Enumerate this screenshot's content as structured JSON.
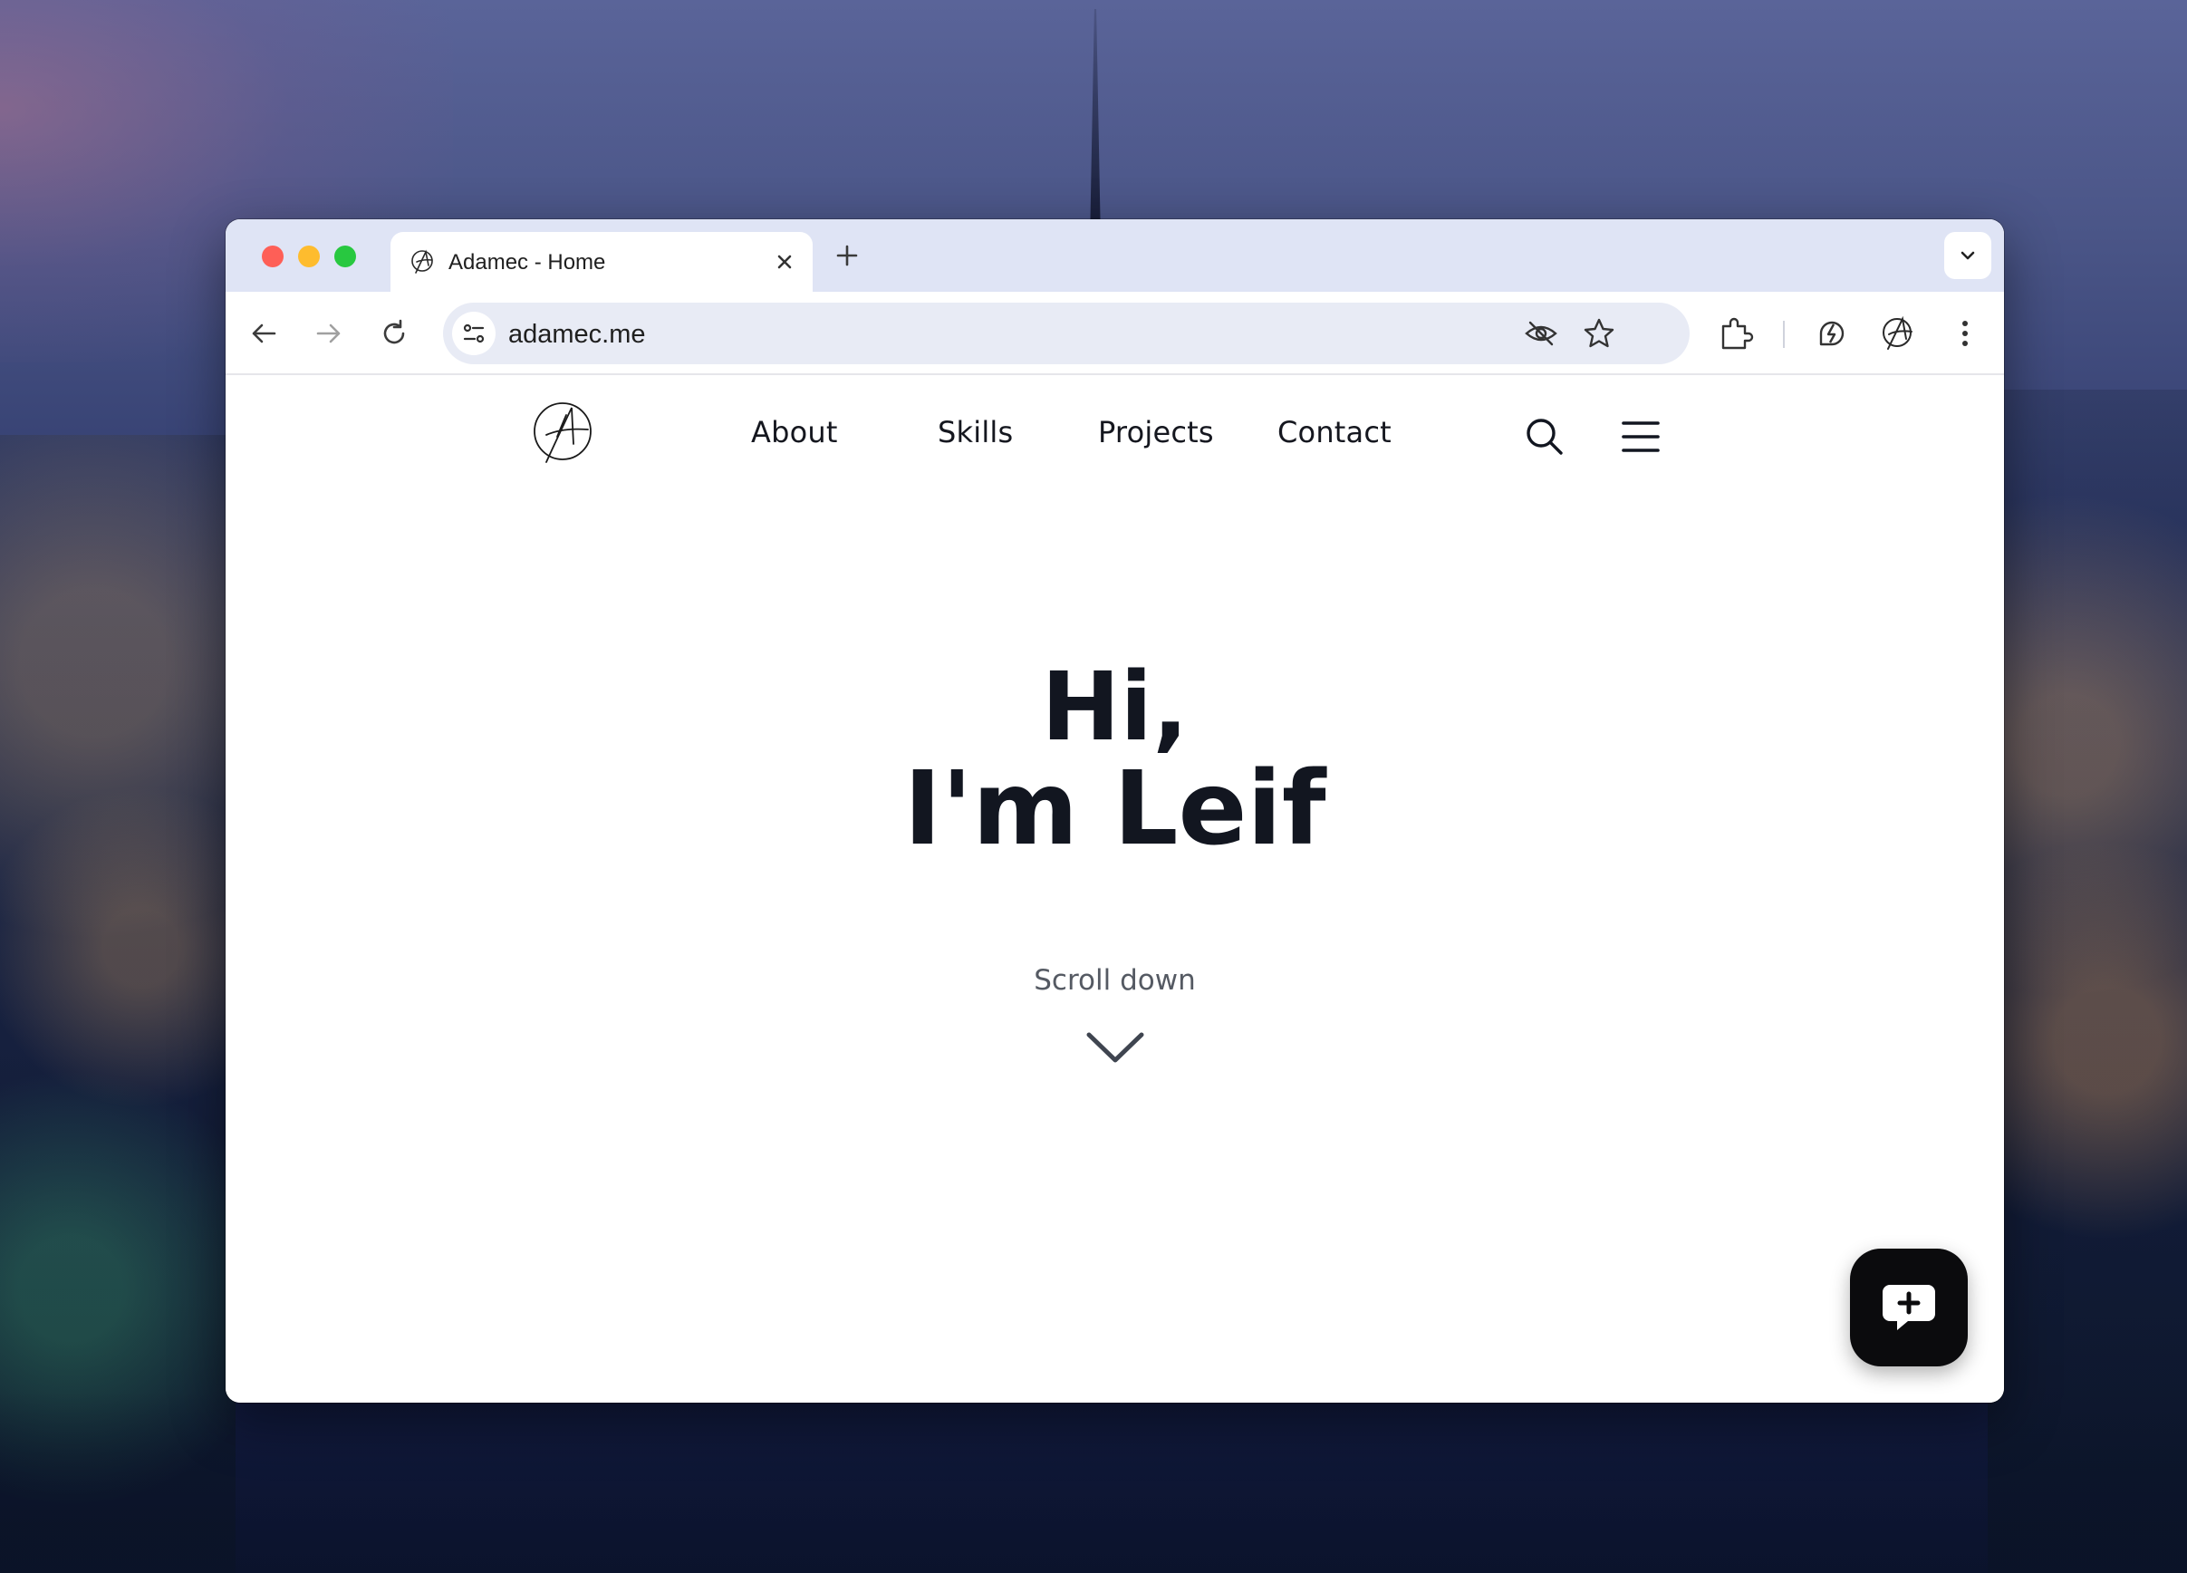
{
  "tab": {
    "title": "Adamec - Home"
  },
  "omnibox": {
    "url": "adamec.me"
  },
  "site": {
    "nav": [
      "About",
      "Skills",
      "Projects",
      "Contact"
    ]
  },
  "hero": {
    "line1": "Hi,",
    "line2": "I'm Leif",
    "scroll_label": "Scroll down"
  },
  "icons": {
    "tab_favicon": "signature-logo-icon",
    "tab_close": "close-icon",
    "new_tab": "plus-icon",
    "tab_search": "chevron-down-icon",
    "back": "arrow-left-icon",
    "forward": "arrow-right-icon",
    "reload": "reload-icon",
    "site_info": "tune-icon",
    "tracking": "eye-off-icon",
    "bookmark": "star-icon",
    "extensions": "puzzle-icon",
    "extension_1": "bolt-icon",
    "extension_2": "signature-logo-icon",
    "browser_menu": "kebab-menu-icon",
    "site_search": "search-icon",
    "site_menu": "hamburger-icon",
    "scroll": "chevron-down-icon",
    "chat": "chat-plus-icon"
  },
  "colors": {
    "tabbar": "#dfe4f5",
    "omnibox": "#e8ebf5",
    "text_dark": "#121620",
    "chat_button": "#0b0b0d"
  }
}
